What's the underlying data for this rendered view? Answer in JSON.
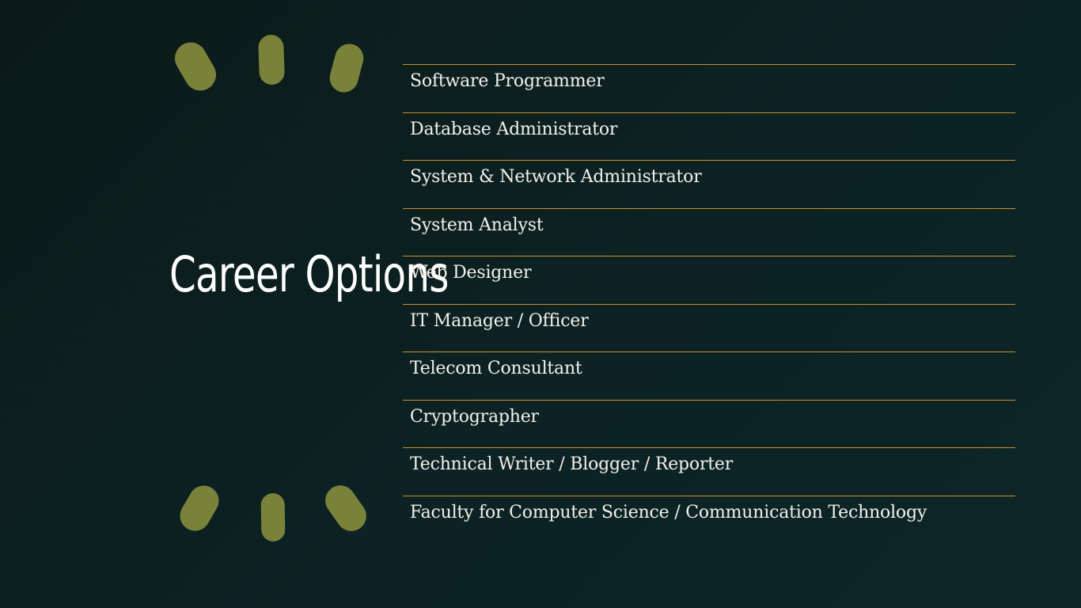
{
  "slide": {
    "title": "Career Options",
    "accent_color": "#c8902a",
    "decoration_color": "#7a823a",
    "background_color": "#0c2224",
    "careers": [
      "Software Programmer",
      "Database Administrator",
      "System & Network Administrator",
      "System Analyst",
      "Web Designer",
      "IT Manager / Officer",
      "Telecom Consultant",
      "Cryptographer",
      "Technical Writer / Blogger / Reporter",
      "Faculty for Computer Science / Communication Technology"
    ]
  }
}
